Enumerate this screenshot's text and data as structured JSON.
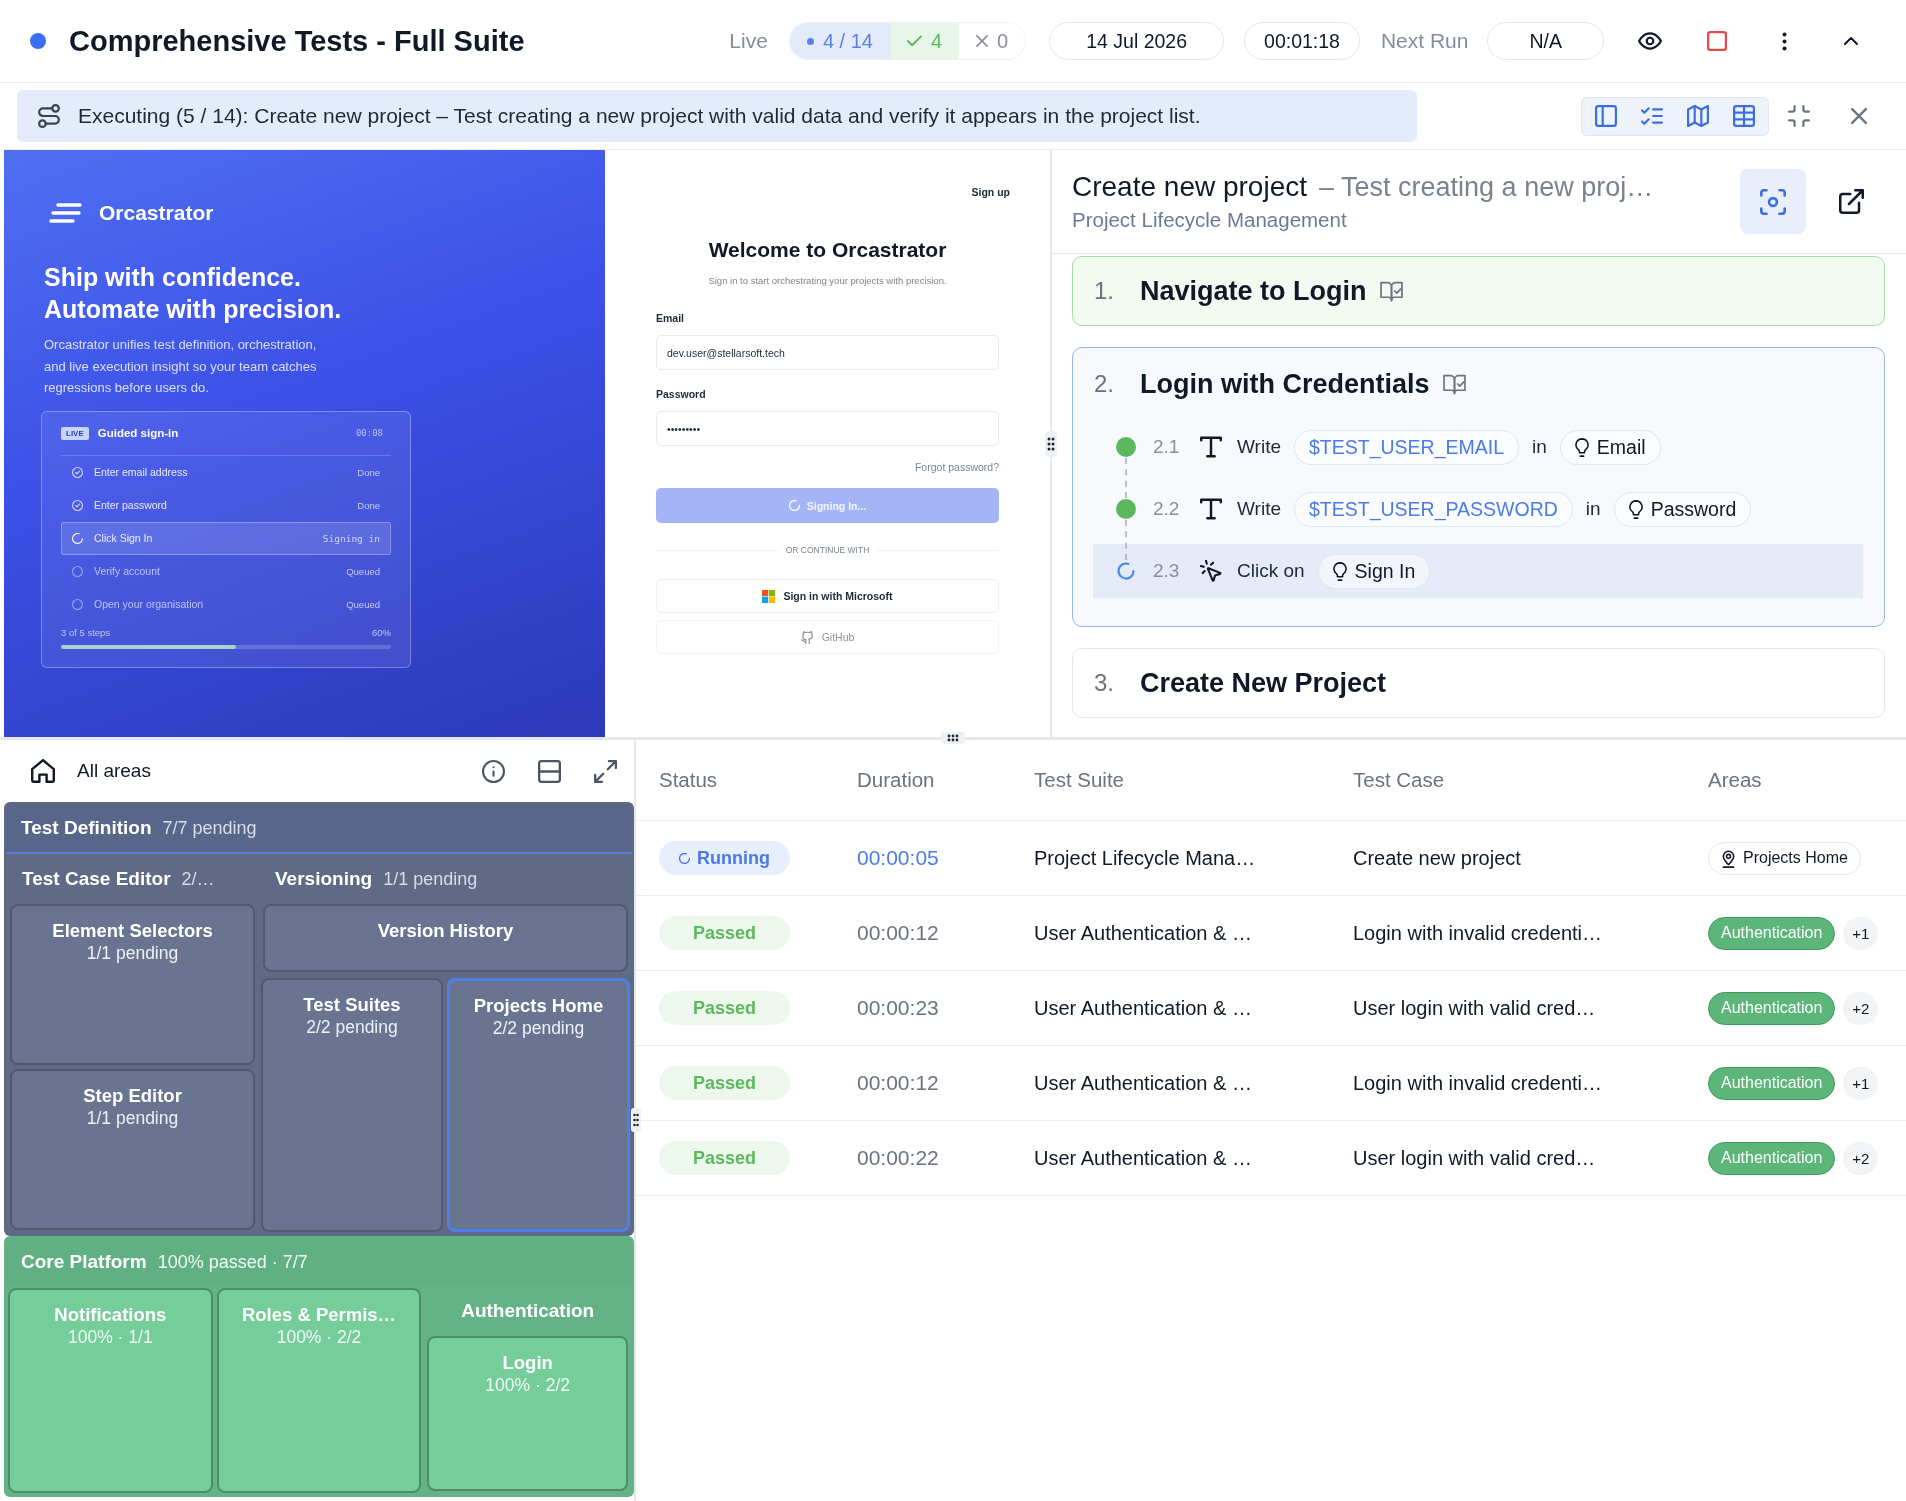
{
  "header": {
    "running": true,
    "title": "Comprehensive Tests - Full Suite",
    "mode": "Live",
    "progress": "4 / 14",
    "passed": "4",
    "failed": "0",
    "date": "14 Jul 2026",
    "elapsed": "00:01:18",
    "next_run_label": "Next Run",
    "next_run": "N/A"
  },
  "banner": {
    "text": "Executing (5 / 14): Create new project – Test creating a new project with valid data and verify it appears in the project list."
  },
  "preview": {
    "brand": "Orcastrator",
    "headline": [
      "Ship with confidence.",
      "Automate with precision."
    ],
    "description": "Orcastrator unifies test definition, orchestration, and live execution insight so your team catches regressions before users do.",
    "live_card": {
      "badge": "LIVE",
      "title": "Guided sign-in",
      "timer": "00:08",
      "steps": [
        {
          "label": "Enter email address",
          "state": "Done",
          "kind": "done"
        },
        {
          "label": "Enter password",
          "state": "Done",
          "kind": "done"
        },
        {
          "label": "Click Sign In",
          "state": "Signing in",
          "kind": "active"
        },
        {
          "label": "Verify account",
          "state": "Queued",
          "kind": "queued"
        },
        {
          "label": "Open your organisation",
          "state": "Queued",
          "kind": "queued"
        }
      ],
      "summary": "3 of 5 steps",
      "percent": "60%",
      "level": 0.53
    },
    "signup_link": "Sign up",
    "form_title": "Welcome to Orcastrator",
    "form_subtitle": "Sign in to start orchestrating your projects with precision.",
    "fields": [
      {
        "label": "Email",
        "value": "dev.user@stellarsoft.tech"
      },
      {
        "label": "Password",
        "value": "•••••••••"
      }
    ],
    "forgot_link": "Forgot password?",
    "submit": {
      "label": "Signing In...",
      "loading": true
    },
    "divider": "OR CONTINUE WITH",
    "providers": [
      {
        "label": "Sign in with Microsoft",
        "kind": "microsoft",
        "disabled": false
      },
      {
        "label": "GitHub",
        "kind": "github",
        "disabled": true
      }
    ]
  },
  "test_detail": {
    "title": "Create new project",
    "description": "– Test creating a new proj…",
    "suite": "Project Lifecycle Management",
    "steps": [
      {
        "number": "1.",
        "title": "Navigate to Login",
        "kind": "passed",
        "book_icon": true
      },
      {
        "number": "2.",
        "title": "Login with Credentials",
        "kind": "running",
        "book_icon": true,
        "substeps": [
          {
            "number": "2.1",
            "kind": "type",
            "action": "Write",
            "value": "$TEST_USER_EMAIL",
            "connector": "in",
            "target": "Email",
            "completed": true,
            "selected": false
          },
          {
            "number": "2.2",
            "kind": "type",
            "action": "Write",
            "value": "$TEST_USER_PASSWORD",
            "connector": "in",
            "target": "Password",
            "completed": true,
            "selected": false
          },
          {
            "number": "2.3",
            "kind": "click",
            "action": "Click on",
            "target": "Sign In",
            "completed": false,
            "selected": true
          }
        ]
      },
      {
        "number": "3.",
        "title": "Create New Project",
        "kind": "pending",
        "book_icon": false
      }
    ]
  },
  "area_map": {
    "home_label": "All areas",
    "groups": [
      {
        "name": "Test Definition",
        "meta": "7/7 pending",
        "kind": "pending",
        "selected": false,
        "children": [
          {
            "name": "Test Case Editor",
            "meta": "2/…",
            "selected": false,
            "children": [
              {
                "name": "Element Selectors",
                "meta": "1/1 pending",
                "selected": false
              },
              {
                "name": "Step Editor",
                "meta": "1/1 pending",
                "selected": false
              }
            ]
          },
          {
            "name": "Versioning",
            "meta": "1/1 pending",
            "selected": false,
            "children": [
              {
                "name": "Version History",
                "selected": false
              }
            ]
          },
          {
            "name": "Test Suites",
            "meta": "2/2 pending",
            "selected": false
          },
          {
            "name": "Projects Home",
            "meta": "2/2 pending",
            "selected": true
          }
        ]
      },
      {
        "name": "Core Platform",
        "meta": "100% passed · 7/7",
        "kind": "passed",
        "selected": false,
        "children": [
          {
            "name": "Notifications",
            "meta": "100% · 1/1",
            "selected": false
          },
          {
            "name": "Roles & Permis…",
            "meta": "100% · 2/2",
            "selected": false
          },
          {
            "name": "Authentication",
            "selected": false,
            "children": [
              {
                "name": "Login",
                "meta": "100% · 2/2",
                "selected": false
              }
            ]
          }
        ]
      }
    ]
  },
  "results_table": {
    "columns": [
      "Status",
      "Duration",
      "Test Suite",
      "Test Case",
      "Areas"
    ],
    "rows": [
      {
        "kind": "running",
        "status_label": "Running",
        "duration": "00:00:05",
        "suite": "Project Lifecycle Mana…",
        "case": "Create new project",
        "areas": [
          {
            "label": "Projects Home",
            "kind": "pending"
          }
        ]
      },
      {
        "kind": "passed",
        "status_label": "Passed",
        "duration": "00:00:12",
        "suite": "User Authentication & …",
        "case": "Login with invalid credenti…",
        "areas": [
          {
            "label": "Authentication",
            "kind": "passed"
          }
        ],
        "more": "+1"
      },
      {
        "kind": "passed",
        "status_label": "Passed",
        "duration": "00:00:23",
        "suite": "User Authentication & …",
        "case": "User login with valid cred…",
        "areas": [
          {
            "label": "Authentication",
            "kind": "passed"
          }
        ],
        "more": "+2"
      },
      {
        "kind": "passed",
        "status_label": "Passed",
        "duration": "00:00:12",
        "suite": "User Authentication & …",
        "case": "Login with invalid credenti…",
        "areas": [
          {
            "label": "Authentication",
            "kind": "passed"
          }
        ],
        "more": "+1"
      },
      {
        "kind": "passed",
        "status_label": "Passed",
        "duration": "00:00:22",
        "suite": "User Authentication & …",
        "case": "User login with valid cred…",
        "areas": [
          {
            "label": "Authentication",
            "kind": "passed"
          }
        ],
        "more": "+2"
      }
    ]
  }
}
